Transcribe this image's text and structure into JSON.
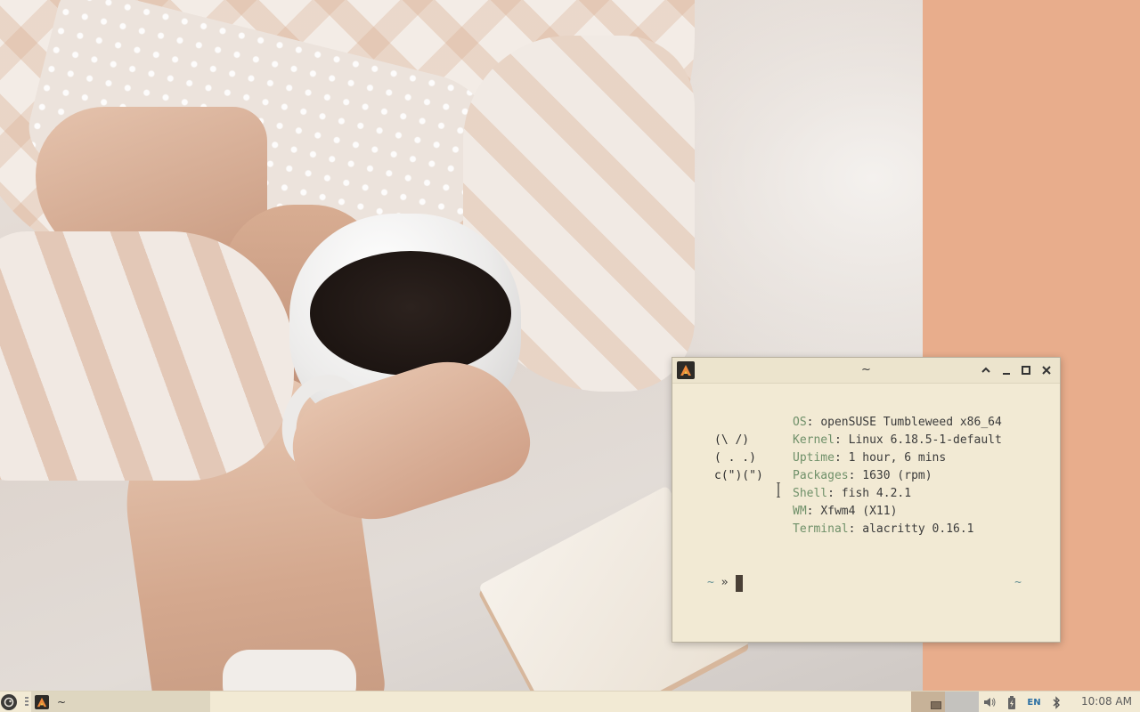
{
  "desktop": {
    "wallpaper": "coffee-cup-sweater-photo",
    "accent_background": "#e8ad8c"
  },
  "terminal": {
    "title": "~",
    "app_icon": "alacritty-icon",
    "ascii_art": [
      "(\\ /)",
      "( . .)",
      "c(\")(\")"
    ],
    "info": [
      {
        "key": "OS",
        "value": "openSUSE Tumbleweed x86_64"
      },
      {
        "key": "Kernel",
        "value": "Linux 6.18.5-1-default"
      },
      {
        "key": "Uptime",
        "value": "1 hour, 6 mins"
      },
      {
        "key": "Packages",
        "value": "1630 (rpm)"
      },
      {
        "key": "Shell",
        "value": "fish 4.2.1"
      },
      {
        "key": "WM",
        "value": "Xfwm4 (X11)"
      },
      {
        "key": "Terminal",
        "value": "alacritty 0.16.1"
      }
    ],
    "prompt_dir": "~",
    "prompt_arrow": "»",
    "right_prompt": "~",
    "colors": {
      "key": "#6f9069",
      "prompt": "#6b9497",
      "background": "#f2ead4"
    }
  },
  "taskbar": {
    "task_label": "~",
    "language": "EN",
    "clock": "10:08 AM"
  }
}
